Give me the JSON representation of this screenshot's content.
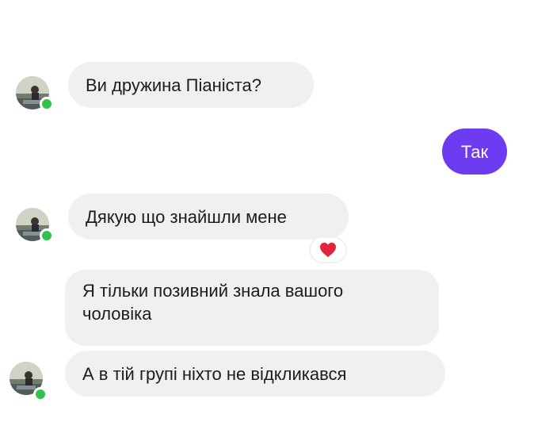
{
  "messages": [
    {
      "id": "m1",
      "direction": "incoming",
      "text": "Ви дружина Піаніста?"
    },
    {
      "id": "m2",
      "direction": "outgoing",
      "text": "Так"
    },
    {
      "id": "m3",
      "direction": "incoming",
      "text": "Дякую що знайшли мене",
      "reaction": "heart-icon"
    },
    {
      "id": "m4",
      "direction": "incoming",
      "text": "Я тільки позивний знала вашого чоловіка"
    },
    {
      "id": "m5",
      "direction": "incoming",
      "text": "А в тій групі ніхто не відкликався"
    }
  ],
  "colors": {
    "incoming_bubble": "#f0f0f0",
    "outgoing_bubble": "#6d3cf0",
    "online_dot": "#31c24d",
    "reaction_heart": "#e0243a"
  }
}
